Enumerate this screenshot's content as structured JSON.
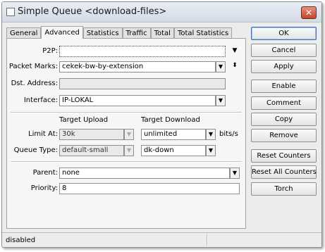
{
  "window": {
    "title": "Simple Queue <download-files>",
    "close_glyph": "✕"
  },
  "tabs": [
    "General",
    "Advanced",
    "Statistics",
    "Traffic",
    "Total",
    "Total Statistics"
  ],
  "form": {
    "p2p": {
      "label": "P2P:",
      "value": ""
    },
    "packet_marks": {
      "label": "Packet Marks:",
      "value": "cekek-bw-by-extension"
    },
    "dst_address": {
      "label": "Dst. Address:",
      "value": ""
    },
    "interface": {
      "label": "Interface:",
      "value": "IP-LOKAL"
    },
    "target_upload_header": "Target Upload",
    "target_download_header": "Target Download",
    "limit_at": {
      "label": "Limit At:",
      "upload": "30k",
      "download": "unlimited",
      "unit": "bits/s"
    },
    "queue_type": {
      "label": "Queue Type:",
      "upload": "default-small",
      "download": "dk-down"
    },
    "parent": {
      "label": "Parent:",
      "value": "none"
    },
    "priority": {
      "label": "Priority:",
      "value": "8"
    }
  },
  "buttons": {
    "ok": "OK",
    "cancel": "Cancel",
    "apply": "Apply",
    "enable": "Enable",
    "comment": "Comment",
    "copy": "Copy",
    "remove": "Remove",
    "reset_counters": "Reset Counters",
    "reset_all_counters": "Reset All Counters",
    "torch": "Torch"
  },
  "status": {
    "text": "disabled"
  },
  "icons": {
    "dropdown": "▼",
    "combo": "⬍",
    "updown": "⬍"
  }
}
